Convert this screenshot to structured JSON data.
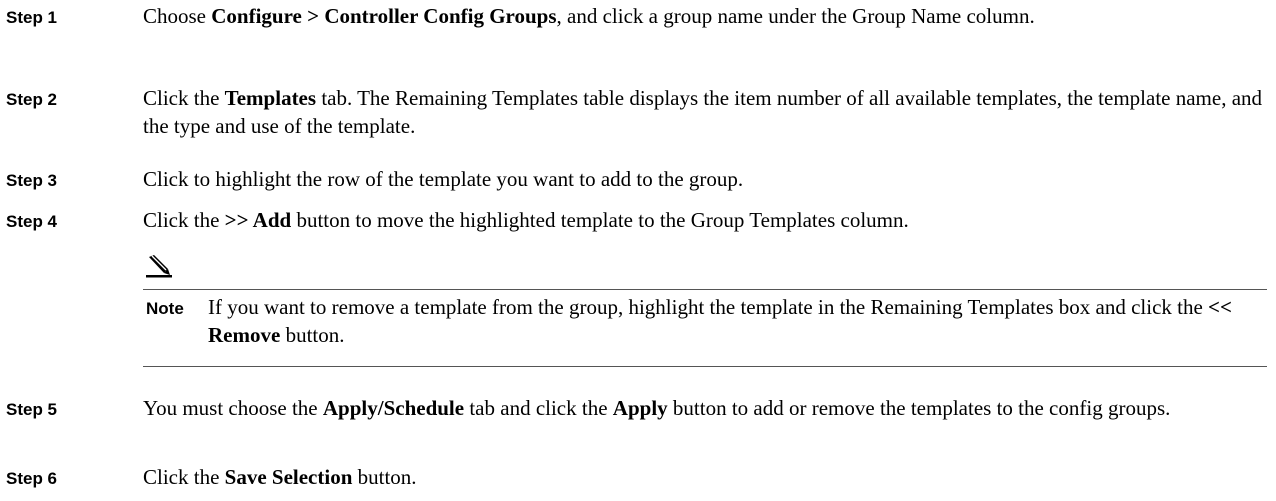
{
  "steps": [
    {
      "label": "Step 1",
      "parts": [
        {
          "t": "Choose "
        },
        {
          "t": "Configure > Controller Config Groups",
          "b": true
        },
        {
          "t": ", and click a group name under the Group Name column."
        }
      ]
    },
    {
      "label": "Step 2",
      "parts": [
        {
          "t": "Click the "
        },
        {
          "t": "Templates",
          "b": true
        },
        {
          "t": " tab. The Remaining Templates table displays the item number of all available templates, the template name, and the type and use of the template."
        }
      ]
    },
    {
      "label": "Step 3",
      "parts": [
        {
          "t": "Click to highlight the row of the template you want to add to the group."
        }
      ]
    },
    {
      "label": "Step 4",
      "parts": [
        {
          "t": "Click the "
        },
        {
          "t": ">> Add",
          "b": true
        },
        {
          "t": " button to move the highlighted template to the Group Templates column."
        }
      ]
    },
    {
      "label": "Step 5",
      "parts": [
        {
          "t": "You must choose the "
        },
        {
          "t": "Apply/Schedule",
          "b": true
        },
        {
          "t": " tab and click the "
        },
        {
          "t": "Apply",
          "b": true
        },
        {
          "t": " button to add or remove the templates to the config groups."
        }
      ]
    },
    {
      "label": "Step 6",
      "parts": [
        {
          "t": "Click the "
        },
        {
          "t": "Save Selection",
          "b": true
        },
        {
          "t": " button."
        }
      ]
    }
  ],
  "note": {
    "icon": "note-pencil-icon",
    "label": "Note",
    "parts": [
      {
        "t": "If you want to remove a template from the group, highlight the template in the Remaining Templates box and click the "
      },
      {
        "t": "<< Remove",
        "b": true
      },
      {
        "t": " button."
      }
    ]
  }
}
